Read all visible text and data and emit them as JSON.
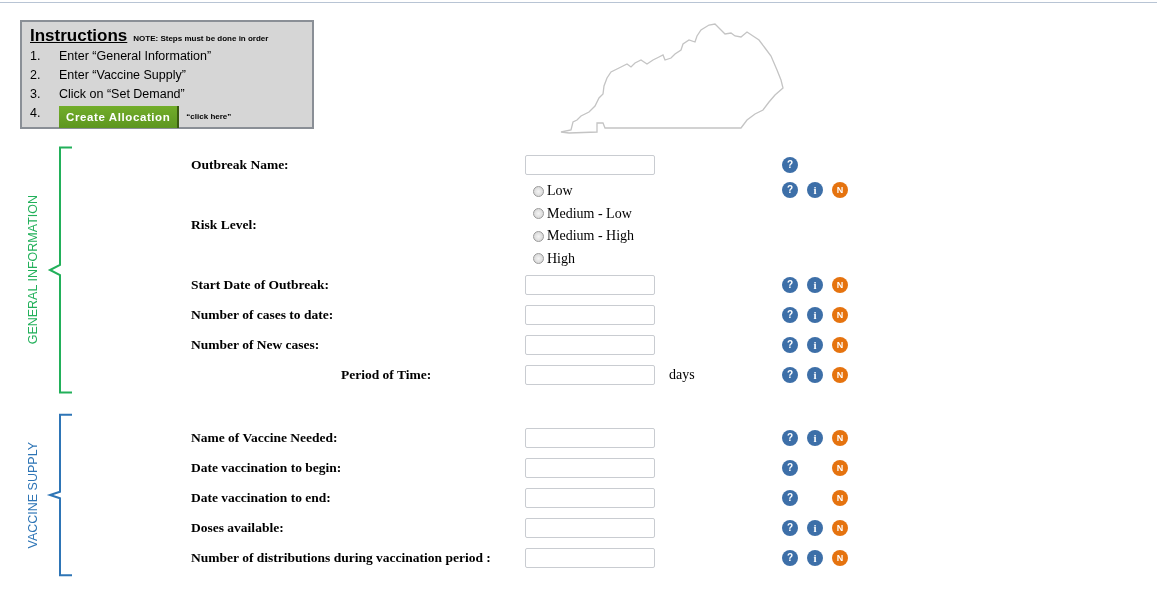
{
  "instructions": {
    "title": "Instructions",
    "note": "NOTE: Steps must be done  in order",
    "steps": [
      {
        "number": "1.",
        "kind": "text",
        "text": "Enter “General Information”"
      },
      {
        "number": "2.",
        "kind": "text",
        "text": "Enter “Vaccine Supply”"
      },
      {
        "number": "3.",
        "kind": "text",
        "text": "Click on “Set Demand”"
      },
      {
        "number": "4.",
        "kind": "button",
        "text": "Create Allocation",
        "hint": "“click here”"
      }
    ]
  },
  "sections": [
    {
      "title": "GENERAL INFORMATION",
      "color": "#22b05a",
      "rows": [
        {
          "label": "Outbreak Name:",
          "kind": "text",
          "icons": [
            {
              "kind": "help",
              "text": "?"
            }
          ]
        },
        {
          "label": "Risk Level:",
          "kind": "radio",
          "options": [
            {
              "label": "Low",
              "selected": false
            },
            {
              "label": "Medium - Low",
              "selected": false
            },
            {
              "label": "Medium - High",
              "selected": false
            },
            {
              "label": "High",
              "selected": false
            }
          ],
          "icons": [
            {
              "kind": "help",
              "text": "?"
            },
            {
              "kind": "info",
              "text": "i"
            },
            {
              "kind": "note",
              "text": "N"
            }
          ]
        },
        {
          "label": "Start Date of Outbreak:",
          "kind": "text",
          "icons": [
            {
              "kind": "help",
              "text": "?"
            },
            {
              "kind": "info",
              "text": "i"
            },
            {
              "kind": "note",
              "text": "N"
            }
          ]
        },
        {
          "label": "Number of cases to date:",
          "kind": "text",
          "icons": [
            {
              "kind": "help",
              "text": "?"
            },
            {
              "kind": "info",
              "text": "i"
            },
            {
              "kind": "note",
              "text": "N"
            }
          ]
        },
        {
          "label": "Number of New cases:",
          "kind": "text",
          "icons": [
            {
              "kind": "help",
              "text": "?"
            },
            {
              "kind": "info",
              "text": "i"
            },
            {
              "kind": "note",
              "text": "N"
            }
          ]
        },
        {
          "label": "Period of Time:",
          "kind": "text",
          "indented": true,
          "suffix": "days",
          "icons": [
            {
              "kind": "help",
              "text": "?"
            },
            {
              "kind": "info",
              "text": "i"
            },
            {
              "kind": "note",
              "text": "N"
            }
          ]
        }
      ]
    },
    {
      "title": "VACCINE SUPPLY",
      "color": "#2e75b6",
      "rows": [
        {
          "label": "Name of Vaccine Needed:",
          "kind": "text",
          "icons": [
            {
              "kind": "help",
              "text": "?"
            },
            {
              "kind": "info",
              "text": "i"
            },
            {
              "kind": "note",
              "text": "N"
            }
          ]
        },
        {
          "label": "Date vaccination to begin:",
          "kind": "text",
          "icons": [
            {
              "kind": "help",
              "text": "?"
            },
            {
              "kind": "note",
              "text": "N"
            }
          ]
        },
        {
          "label": "Date vaccination to end:",
          "kind": "text",
          "icons": [
            {
              "kind": "help",
              "text": "?"
            },
            {
              "kind": "note",
              "text": "N"
            }
          ]
        },
        {
          "label": "Doses available:",
          "kind": "text",
          "icons": [
            {
              "kind": "help",
              "text": "?"
            },
            {
              "kind": "info",
              "text": "i"
            },
            {
              "kind": "note",
              "text": "N"
            }
          ]
        },
        {
          "label": "Number of distributions during vaccination period :",
          "kind": "text",
          "icons": [
            {
              "kind": "help",
              "text": "?"
            },
            {
              "kind": "info",
              "text": "i"
            },
            {
              "kind": "note",
              "text": "N"
            }
          ]
        }
      ]
    }
  ]
}
